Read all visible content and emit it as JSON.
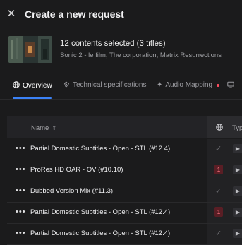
{
  "header": {
    "title": "Create a new request",
    "close_icon": "close-icon"
  },
  "selection": {
    "title": "12 contents selected (3 titles)",
    "subtitle": "Sonic 2 - le film, The corporation, Matrix Resurrections"
  },
  "tabs": [
    {
      "label": "Overview",
      "icon": "globe-icon",
      "active": true
    },
    {
      "label": "Technical specifications",
      "icon": "gear-icon",
      "active": false
    },
    {
      "label": "Audio Mapping",
      "icon": "diamond-icon",
      "active": false,
      "alert": true
    },
    {
      "label": "",
      "icon": "monitor-icon",
      "active": false
    }
  ],
  "table": {
    "columns": {
      "name": "Name",
      "type": "Typ"
    },
    "rows": [
      {
        "name": "Partial Domestic Subtitles - Open - STL (#12.4)",
        "status": "check"
      },
      {
        "name": "ProRes HD OAR - OV (#10.10)",
        "status": "badge",
        "badge": "1"
      },
      {
        "name": "Dubbed Version Mix (#11.3)",
        "status": "check"
      },
      {
        "name": "Partial Domestic Subtitles - Open - STL (#12.4)",
        "status": "badge",
        "badge": "1"
      },
      {
        "name": "Partial Domestic Subtitles - Open - STL (#12.4)",
        "status": "check"
      }
    ]
  },
  "colors": {
    "accent": "#3b82f6",
    "alert": "#ff4d5e",
    "background": "#1b1b1c"
  }
}
